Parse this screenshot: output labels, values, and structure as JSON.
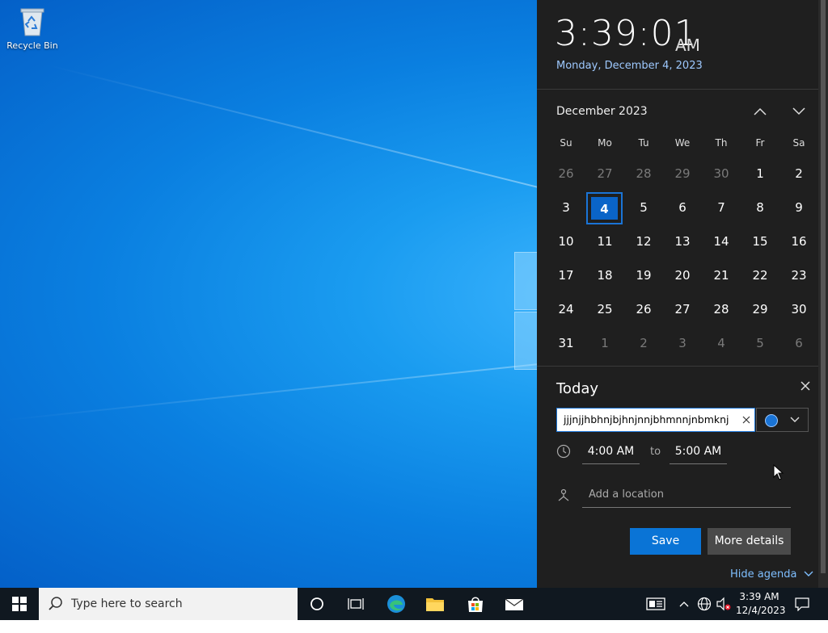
{
  "desktop": {
    "icons": [
      {
        "label": "Recycle Bin",
        "icon": "recycle-bin-icon"
      }
    ]
  },
  "clock": {
    "time": "3:39:01",
    "ampm": "AM",
    "date": "Monday, December 4, 2023"
  },
  "calendar": {
    "month_label": "December 2023",
    "weekdays": [
      "Su",
      "Mo",
      "Tu",
      "We",
      "Th",
      "Fr",
      "Sa"
    ],
    "weeks": [
      [
        "26",
        "27",
        "28",
        "29",
        "30",
        "1",
        "2"
      ],
      [
        "3",
        "4",
        "5",
        "6",
        "7",
        "8",
        "9"
      ],
      [
        "10",
        "11",
        "12",
        "13",
        "14",
        "15",
        "16"
      ],
      [
        "17",
        "18",
        "19",
        "20",
        "21",
        "22",
        "23"
      ],
      [
        "24",
        "25",
        "26",
        "27",
        "28",
        "29",
        "30"
      ],
      [
        "31",
        "1",
        "2",
        "3",
        "4",
        "5",
        "6"
      ]
    ],
    "selected_day": "4"
  },
  "agenda": {
    "title": "Today",
    "event_title_value": "jjjnjjhbhnjbjhnjnnjbhmnnjnbmknj",
    "color_accent": "#1a74d6",
    "start_time": "4:00 AM",
    "to_label": "to",
    "end_time": "5:00 AM",
    "location_placeholder": "Add a location",
    "save_label": "Save",
    "more_details_label": "More details",
    "hide_agenda_label": "Hide agenda"
  },
  "taskbar": {
    "search_placeholder": "Type here to search",
    "tray_time": "3:39 AM",
    "tray_date": "12/4/2023"
  },
  "colors": {
    "flyout_bg": "#1f1f1f",
    "accent": "#0a74d6",
    "taskbar_bg": "#101820"
  }
}
